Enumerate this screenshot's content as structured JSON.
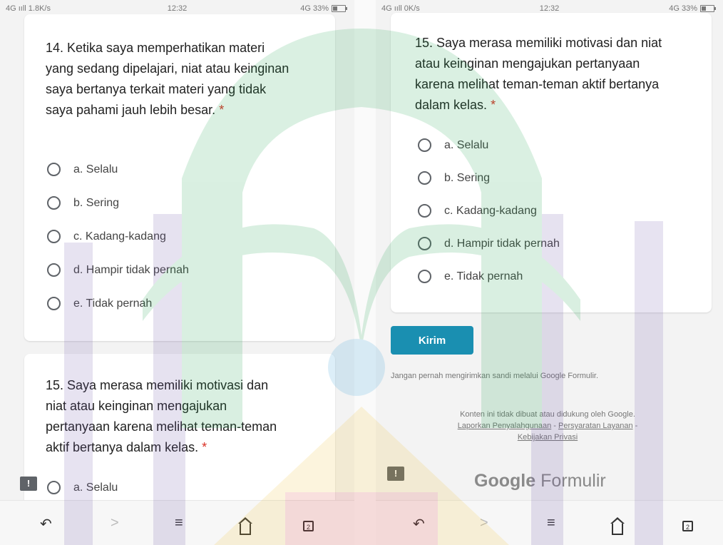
{
  "colors": {
    "accent": "#1a8fb1",
    "required": "#d93025",
    "watermark_green": "#1ba14a",
    "watermark_purple": "#6a4fa5",
    "watermark_yellow": "#f2c230",
    "watermark_red": "#e0433b"
  },
  "left": {
    "status": {
      "network": "4G ııll 1.8K/s",
      "time": "12:32",
      "battery": "4G 33%"
    },
    "q14": {
      "text": "14. Ketika saya memperhatikan materi yang sedang dipelajari, niat atau keinginan saya bertanya terkait materi yang tidak saya pahami jauh lebih besar.",
      "required": "*",
      "options": [
        "a. Selalu",
        "b. Sering",
        "c. Kadang-kadang",
        "d. Hampir tidak pernah",
        "e. Tidak pernah"
      ]
    },
    "q15": {
      "text": "15. Saya merasa memiliki motivasi dan niat atau keinginan mengajukan pertanyaan karena melihat teman-teman aktif bertanya dalam kelas.",
      "required": "*",
      "first_option": "a. Selalu"
    },
    "nav": {
      "back": "↶",
      "forward": ">",
      "menu": "≡",
      "home": "home",
      "tabs": "2"
    }
  },
  "right": {
    "status": {
      "network": "4G ııll 0K/s",
      "time": "12:32",
      "battery": "4G 33%"
    },
    "q15": {
      "text": "15. Saya merasa memiliki motivasi dan niat atau keinginan mengajukan pertanyaan karena melihat teman-teman aktif bertanya dalam kelas.",
      "required": "*",
      "options": [
        "a. Selalu",
        "b. Sering",
        "c. Kadang-kadang",
        "d. Hampir tidak pernah",
        "e. Tidak pernah"
      ]
    },
    "submit_label": "Kirim",
    "password_warning": "Jangan pernah mengirimkan sandi melalui Google Formulir.",
    "disclaimer": "Konten ini tidak dibuat atau didukung oleh Google.",
    "links": {
      "abuse": "Laporkan Penyalahgunaan",
      "sep1": "-",
      "terms": "Persyaratan Layanan",
      "sep2": "-",
      "privacy": "Kebijakan Privasi"
    },
    "brand": {
      "google": "Google",
      "formulir": "Formulir"
    },
    "nav": {
      "back": "↶",
      "forward": ">",
      "menu": "≡",
      "home": "home",
      "tabs": "2"
    }
  }
}
